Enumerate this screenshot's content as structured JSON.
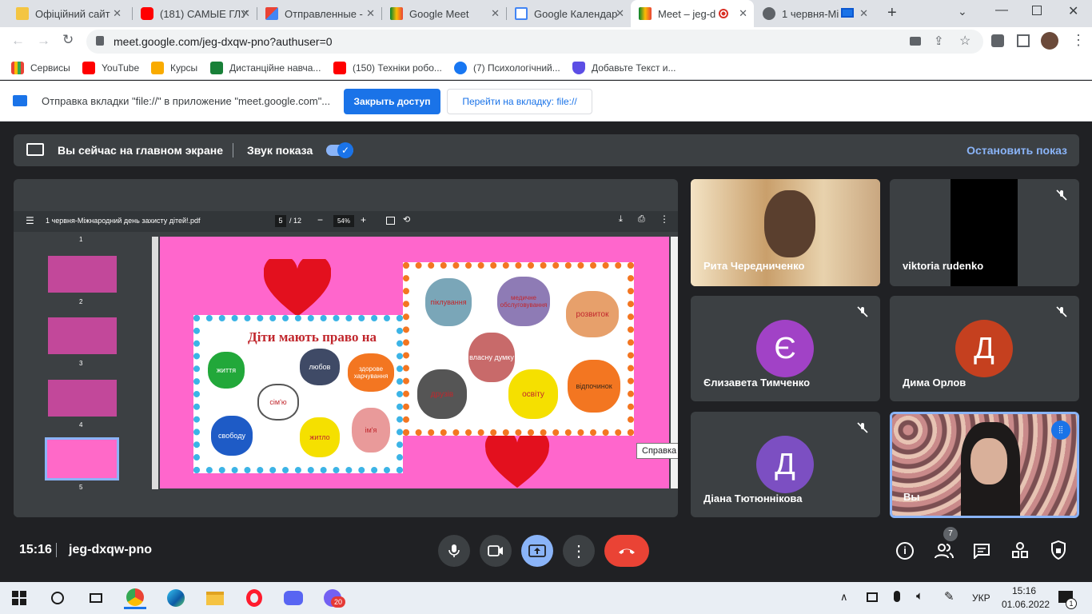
{
  "tabs": [
    {
      "title": "Офіційний сайт",
      "favicon": "site-icon"
    },
    {
      "title": "(181) САМЫЕ ГЛУ",
      "favicon": "youtube-icon"
    },
    {
      "title": "Отправленные -",
      "favicon": "gmail-icon"
    },
    {
      "title": "Google Meet",
      "favicon": "meet-icon"
    },
    {
      "title": "Google Календар",
      "favicon": "calendar-icon"
    },
    {
      "title": "Meet – jeg-d",
      "favicon": "meet-icon"
    },
    {
      "title": "1 червня-Мі",
      "favicon": "globe-icon"
    }
  ],
  "address": {
    "url": "meet.google.com/jeg-dxqw-pno?authuser=0"
  },
  "bookmarks": [
    {
      "label": "Сервисы",
      "icon": "apps-icon"
    },
    {
      "label": "YouTube",
      "icon": "youtube-icon"
    },
    {
      "label": "Курсы",
      "icon": "classroom-icon"
    },
    {
      "label": "Дистанційне навча...",
      "icon": "sheets-icon"
    },
    {
      "label": "(150) Техніки робо...",
      "icon": "youtube-icon"
    },
    {
      "label": "(7) Психологічний...",
      "icon": "facebook-icon"
    },
    {
      "label": "Добавьте Текст и...",
      "icon": "shield-icon"
    }
  ],
  "infobar": {
    "message": "Отправка вкладки \"file://\" в приложение \"meet.google.com\"...",
    "primary_button": "Закрыть доступ",
    "secondary_button": "Перейти на вкладку: file://"
  },
  "share": {
    "status": "Вы сейчас на главном экране",
    "sound_label": "Звук показа",
    "stop_label": "Остановить показ"
  },
  "pdf": {
    "filename": "1 червня-Міжнародний день захисту дітей!.pdf",
    "page_current": "5",
    "page_total": "/ 12",
    "zoom": "54%",
    "thumbs": [
      "1",
      "2",
      "3",
      "4",
      "5"
    ],
    "slide_title": "Діти мають право на",
    "hands_left": [
      "життя",
      "любов",
      "здорове харчування",
      "сім'ю",
      "свободу",
      "житло",
      "ім'я"
    ],
    "hands_right": [
      "піклування",
      "медичне обслуговування",
      "розвиток",
      "власну думку",
      "друзів",
      "освіту",
      "відпочинок"
    ],
    "tooltip": "Справка"
  },
  "participants": [
    {
      "name": "Рита Чередниченко",
      "type": "video",
      "muted": false
    },
    {
      "name": "viktoria rudenko",
      "type": "video",
      "muted": true
    },
    {
      "name": "Єлизавета Тимченко",
      "initial": "Є",
      "color": "#a142c6",
      "muted": true
    },
    {
      "name": "Дима Орлов",
      "initial": "Д",
      "color": "#c5401f",
      "muted": true
    },
    {
      "name": "Діана Тютюннікова",
      "initial": "Д",
      "color": "#7c4fc2",
      "muted": true
    },
    {
      "name": "Вы",
      "type": "video",
      "muted": false
    }
  ],
  "bottom": {
    "time": "15:16",
    "meeting_code": "jeg-dxqw-pno",
    "people_count": "7"
  },
  "taskbar": {
    "lang": "УКР",
    "time": "15:16",
    "date": "01.06.2022",
    "viber_badge": "20",
    "notif_badge": "1"
  }
}
